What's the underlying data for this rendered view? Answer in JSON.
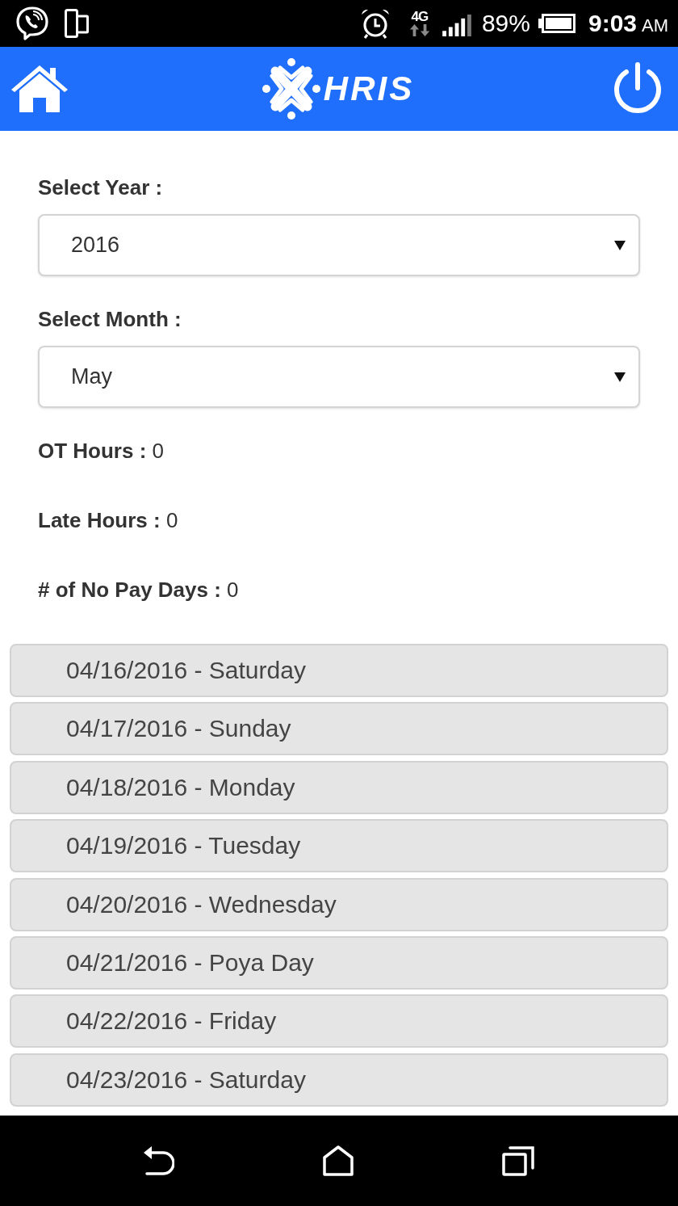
{
  "status_bar": {
    "network": "4G",
    "battery": "89%",
    "time": "9:03",
    "meridiem": "AM"
  },
  "header": {
    "logo_text": "HRIS"
  },
  "filters": [
    {
      "label": "Select Year :",
      "value": "2016"
    },
    {
      "label": "Select Month :",
      "value": "May"
    }
  ],
  "summary": [
    "**OT Hours :** 0",
    "**Late Hours :** 0",
    "**# of No Pay Days :** 0"
  ],
  "days": [
    "04/16/2016 - Saturday",
    "04/17/2016 - Sunday",
    "04/18/2016 - Monday",
    "04/19/2016 - Tuesday",
    "04/20/2016 - Wednesday",
    "04/21/2016 - Poya Day",
    "04/22/2016 - Friday",
    "04/23/2016 - Saturday"
  ]
}
